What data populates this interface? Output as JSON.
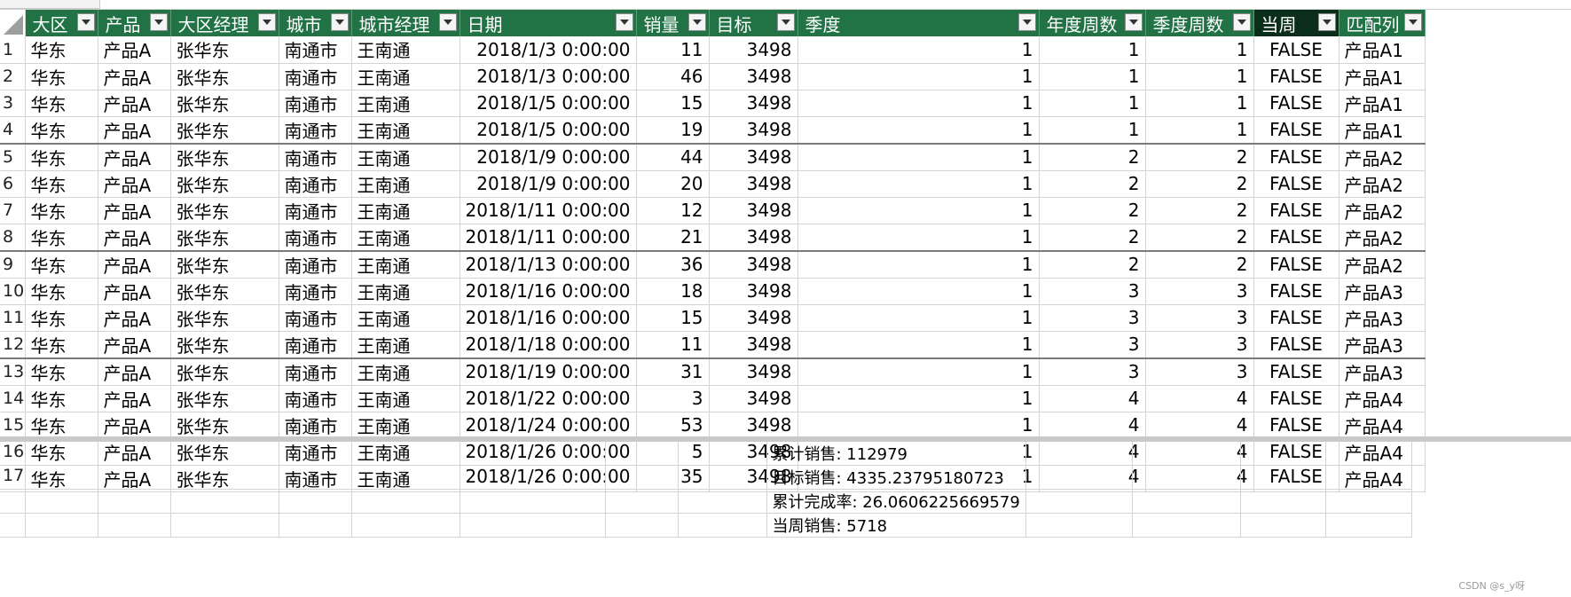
{
  "columns": [
    {
      "label": "大区"
    },
    {
      "label": "产品"
    },
    {
      "label": "大区经理"
    },
    {
      "label": "城市"
    },
    {
      "label": "城市经理"
    },
    {
      "label": "日期"
    },
    {
      "label": "销量"
    },
    {
      "label": "目标"
    },
    {
      "label": "季度"
    },
    {
      "label": "年度周数"
    },
    {
      "label": "季度周数"
    },
    {
      "label": "当周"
    },
    {
      "label": "匹配列"
    }
  ],
  "rows": [
    {
      "num": "1",
      "cells": [
        "华东",
        "产品A",
        "张华东",
        "南通市",
        "王南通",
        "2018/1/3 0:00:00",
        "11",
        "3498",
        "1",
        "1",
        "1",
        "FALSE",
        "产品A1"
      ]
    },
    {
      "num": "2",
      "cells": [
        "华东",
        "产品A",
        "张华东",
        "南通市",
        "王南通",
        "2018/1/3 0:00:00",
        "46",
        "3498",
        "1",
        "1",
        "1",
        "FALSE",
        "产品A1"
      ]
    },
    {
      "num": "3",
      "cells": [
        "华东",
        "产品A",
        "张华东",
        "南通市",
        "王南通",
        "2018/1/5 0:00:00",
        "15",
        "3498",
        "1",
        "1",
        "1",
        "FALSE",
        "产品A1"
      ]
    },
    {
      "num": "4",
      "cells": [
        "华东",
        "产品A",
        "张华东",
        "南通市",
        "王南通",
        "2018/1/5 0:00:00",
        "19",
        "3498",
        "1",
        "1",
        "1",
        "FALSE",
        "产品A1"
      ]
    },
    {
      "num": "5",
      "cells": [
        "华东",
        "产品A",
        "张华东",
        "南通市",
        "王南通",
        "2018/1/9 0:00:00",
        "44",
        "3498",
        "1",
        "2",
        "2",
        "FALSE",
        "产品A2"
      ]
    },
    {
      "num": "6",
      "cells": [
        "华东",
        "产品A",
        "张华东",
        "南通市",
        "王南通",
        "2018/1/9 0:00:00",
        "20",
        "3498",
        "1",
        "2",
        "2",
        "FALSE",
        "产品A2"
      ]
    },
    {
      "num": "7",
      "cells": [
        "华东",
        "产品A",
        "张华东",
        "南通市",
        "王南通",
        "2018/1/11 0:00:00",
        "12",
        "3498",
        "1",
        "2",
        "2",
        "FALSE",
        "产品A2"
      ]
    },
    {
      "num": "8",
      "cells": [
        "华东",
        "产品A",
        "张华东",
        "南通市",
        "王南通",
        "2018/1/11 0:00:00",
        "21",
        "3498",
        "1",
        "2",
        "2",
        "FALSE",
        "产品A2"
      ]
    },
    {
      "num": "9",
      "cells": [
        "华东",
        "产品A",
        "张华东",
        "南通市",
        "王南通",
        "2018/1/13 0:00:00",
        "36",
        "3498",
        "1",
        "2",
        "2",
        "FALSE",
        "产品A2"
      ]
    },
    {
      "num": "10",
      "cells": [
        "华东",
        "产品A",
        "张华东",
        "南通市",
        "王南通",
        "2018/1/16 0:00:00",
        "18",
        "3498",
        "1",
        "3",
        "3",
        "FALSE",
        "产品A3"
      ]
    },
    {
      "num": "11",
      "cells": [
        "华东",
        "产品A",
        "张华东",
        "南通市",
        "王南通",
        "2018/1/16 0:00:00",
        "15",
        "3498",
        "1",
        "3",
        "3",
        "FALSE",
        "产品A3"
      ]
    },
    {
      "num": "12",
      "cells": [
        "华东",
        "产品A",
        "张华东",
        "南通市",
        "王南通",
        "2018/1/18 0:00:00",
        "11",
        "3498",
        "1",
        "3",
        "3",
        "FALSE",
        "产品A3"
      ]
    },
    {
      "num": "13",
      "cells": [
        "华东",
        "产品A",
        "张华东",
        "南通市",
        "王南通",
        "2018/1/19 0:00:00",
        "31",
        "3498",
        "1",
        "3",
        "3",
        "FALSE",
        "产品A3"
      ]
    },
    {
      "num": "14",
      "cells": [
        "华东",
        "产品A",
        "张华东",
        "南通市",
        "王南通",
        "2018/1/22 0:00:00",
        "3",
        "3498",
        "1",
        "4",
        "4",
        "FALSE",
        "产品A4"
      ]
    },
    {
      "num": "15",
      "cells": [
        "华东",
        "产品A",
        "张华东",
        "南通市",
        "王南通",
        "2018/1/24 0:00:00",
        "53",
        "3498",
        "1",
        "4",
        "4",
        "FALSE",
        "产品A4"
      ]
    },
    {
      "num": "16",
      "cells": [
        "华东",
        "产品A",
        "张华东",
        "南通市",
        "王南通",
        "2018/1/26 0:00:00",
        "5",
        "3498",
        "1",
        "4",
        "4",
        "FALSE",
        "产品A4"
      ]
    },
    {
      "num": "17",
      "cells": [
        "华东",
        "产品A",
        "张华东",
        "南通市",
        "王南通",
        "2018/1/26 0:00:00",
        "35",
        "3498",
        "1",
        "4",
        "4",
        "FALSE",
        "产品A4"
      ]
    }
  ],
  "measures": [
    "累计销售: 112979",
    "目标销售: 4335.23795180723",
    "累计完成率: 26.0606225669579",
    "当周销售: 5718"
  ],
  "watermark": "CSDN @s_y呀"
}
